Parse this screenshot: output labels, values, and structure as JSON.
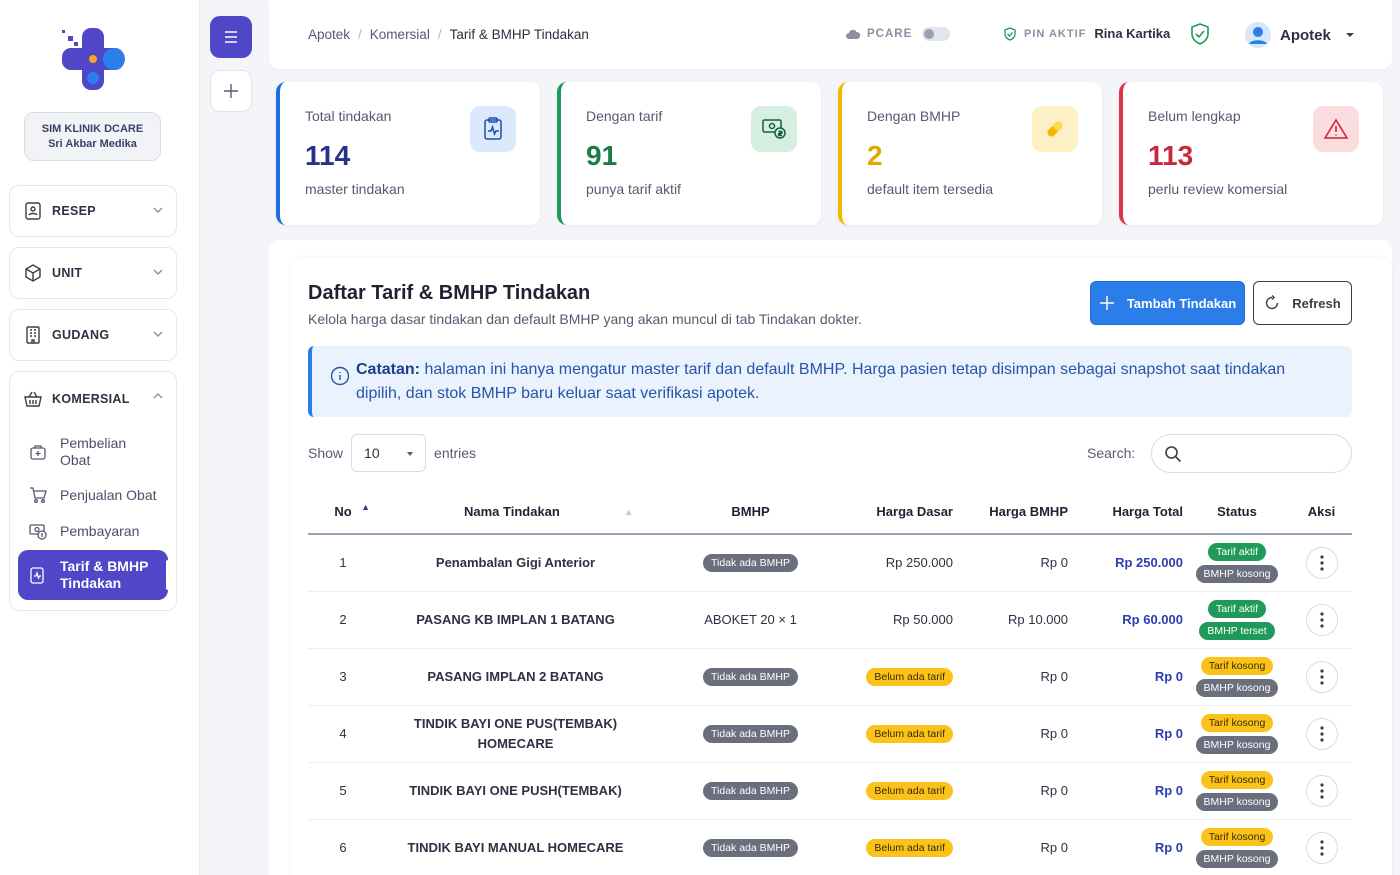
{
  "sidebar": {
    "clinic_line1": "SIM KLINIK DCARE",
    "clinic_line2": "Sri Akbar Medika",
    "groups": [
      {
        "label": "RESEP",
        "icon": "prescription-icon"
      },
      {
        "label": "UNIT",
        "icon": "cube-icon"
      },
      {
        "label": "GUDANG",
        "icon": "building-icon"
      },
      {
        "label": "KOMERSIAL",
        "icon": "basket-icon"
      }
    ],
    "komersial_items": [
      {
        "label": "Pembelian Obat",
        "icon": "bag-plus-icon"
      },
      {
        "label": "Penjualan Obat",
        "icon": "cart-icon"
      },
      {
        "label": "Pembayaran",
        "icon": "cash-icon"
      },
      {
        "label": "Tarif & BMHP Tindakan",
        "icon": "clipboard-pulse-icon",
        "active": true
      }
    ]
  },
  "topbar": {
    "breadcrumb": [
      "Apotek",
      "Komersial",
      "Tarif & BMHP Tindakan"
    ],
    "pcare_label": "PCARE",
    "pin_label": "PIN AKTIF",
    "pin_name": "Rina Kartika",
    "user_role": "Apotek"
  },
  "stats": [
    {
      "label": "Total tindakan",
      "value": "114",
      "sub": "master tindakan",
      "color": "#1f6fe0"
    },
    {
      "label": "Dengan tarif",
      "value": "91",
      "sub": "punya tarif aktif",
      "color": "#1f9a5a"
    },
    {
      "label": "Dengan BMHP",
      "value": "2",
      "sub": "default item tersedia",
      "color": "#f5b800"
    },
    {
      "label": "Belum lengkap",
      "value": "113",
      "sub": "perlu review komersial",
      "color": "#dc3545"
    }
  ],
  "main": {
    "title": "Daftar Tarif & BMHP Tindakan",
    "subtitle": "Kelola harga dasar tindakan dan default BMHP yang akan muncul di tab Tindakan dokter.",
    "add_button": "Tambah Tindakan",
    "refresh_button": "Refresh",
    "note_bold": "Catatan:",
    "note_text": " halaman ini hanya mengatur master tarif dan default BMHP. Harga pasien tetap disimpan sebagai snapshot saat tindakan dipilih, dan stok BMHP baru keluar saat verifikasi apotek.",
    "show_label": "Show",
    "entries_value": "10",
    "entries_label": "entries",
    "search_label": "Search:"
  },
  "table": {
    "headers": [
      "No",
      "Nama Tindakan",
      "BMHP",
      "Harga Dasar",
      "Harga BMHP",
      "Harga Total",
      "Status",
      "Aksi"
    ],
    "rows": [
      {
        "no": "1",
        "nama": "Penambalan Gigi Anterior",
        "bmhp": "Tidak ada BMHP",
        "bmhp_pill": true,
        "dasar": "Rp 250.000",
        "dasar_pill": false,
        "hbmhp": "Rp 0",
        "total": "Rp 250.000",
        "status1": "Tarif aktif",
        "status1_type": "green",
        "status2": "BMHP kosong",
        "status2_type": "dark"
      },
      {
        "no": "2",
        "nama": "PASANG KB IMPLAN 1 BATANG",
        "bmhp": "ABOKET 20 × 1",
        "bmhp_pill": false,
        "dasar": "Rp 50.000",
        "dasar_pill": false,
        "hbmhp": "Rp 10.000",
        "total": "Rp 60.000",
        "status1": "Tarif aktif",
        "status1_type": "green",
        "status2": "BMHP terset",
        "status2_type": "green"
      },
      {
        "no": "3",
        "nama": "PASANG IMPLAN 2 BATANG",
        "bmhp": "Tidak ada BMHP",
        "bmhp_pill": true,
        "dasar": "Belum ada tarif",
        "dasar_pill": true,
        "hbmhp": "Rp 0",
        "total": "Rp 0",
        "status1": "Tarif kosong",
        "status1_type": "yellow",
        "status2": "BMHP kosong",
        "status2_type": "dark"
      },
      {
        "no": "4",
        "nama": "TINDIK BAYI ONE PUS(TEMBAK) HOMECARE",
        "bmhp": "Tidak ada BMHP",
        "bmhp_pill": true,
        "dasar": "Belum ada tarif",
        "dasar_pill": true,
        "hbmhp": "Rp 0",
        "total": "Rp 0",
        "status1": "Tarif kosong",
        "status1_type": "yellow",
        "status2": "BMHP kosong",
        "status2_type": "dark"
      },
      {
        "no": "5",
        "nama": "TINDIK BAYI ONE PUSH(TEMBAK)",
        "bmhp": "Tidak ada BMHP",
        "bmhp_pill": true,
        "dasar": "Belum ada tarif",
        "dasar_pill": true,
        "hbmhp": "Rp 0",
        "total": "Rp 0",
        "status1": "Tarif kosong",
        "status1_type": "yellow",
        "status2": "BMHP kosong",
        "status2_type": "dark"
      },
      {
        "no": "6",
        "nama": "TINDIK BAYI MANUAL HOMECARE",
        "bmhp": "Tidak ada BMHP",
        "bmhp_pill": true,
        "dasar": "Belum ada tarif",
        "dasar_pill": true,
        "hbmhp": "Rp 0",
        "total": "Rp 0",
        "status1": "Tarif kosong",
        "status1_type": "yellow",
        "status2": "BMHP kosong",
        "status2_type": "dark"
      }
    ]
  }
}
